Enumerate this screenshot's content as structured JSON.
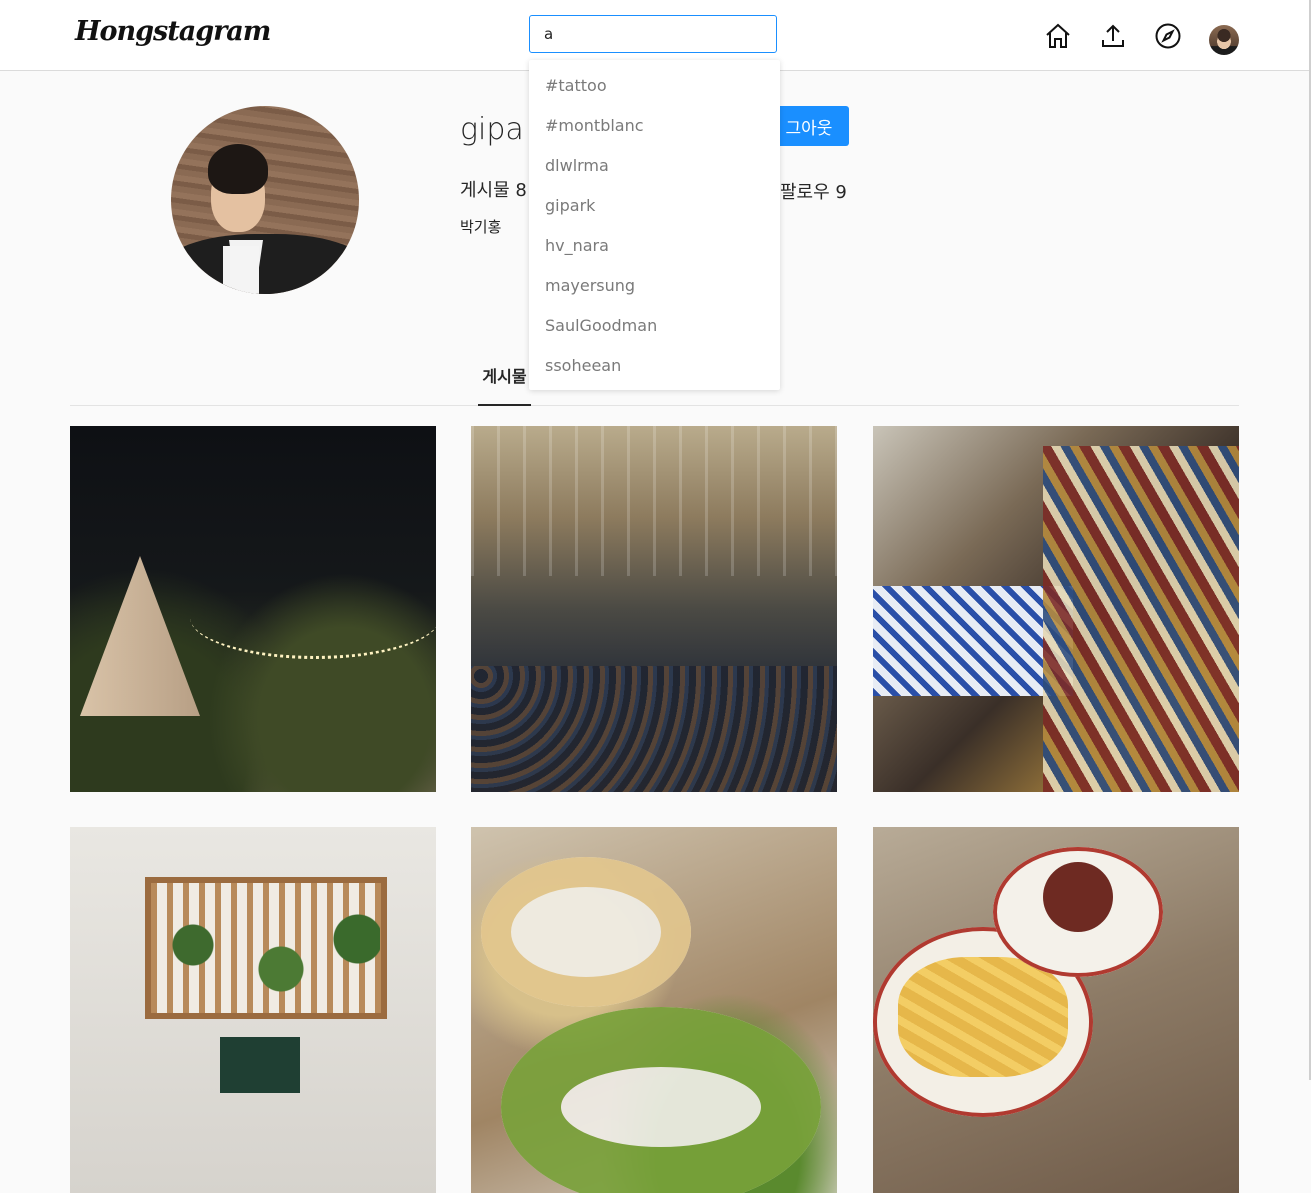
{
  "header": {
    "logo": "Hongstagram",
    "search": {
      "value": "a"
    },
    "nav": [
      "home-icon",
      "upload-icon",
      "compass-icon",
      "profile-avatar"
    ]
  },
  "profile": {
    "username": "gipa",
    "logout_label": "그아웃",
    "posts_stat": "게시물 8",
    "follow_stat": "팔로우 9",
    "full_name": "박기홍"
  },
  "tabs": {
    "posts_label": "게시물"
  },
  "search_results": [
    "#tattoo",
    "#montblanc",
    "dlwlrma",
    "gipark",
    "hv_nara",
    "mayersung",
    "SaulGoodman",
    "ssoheean"
  ],
  "colors": {
    "accent": "#1a8fff",
    "background": "#fafafa",
    "text": "#262626",
    "suggestion_text": "#7a7a7a"
  }
}
